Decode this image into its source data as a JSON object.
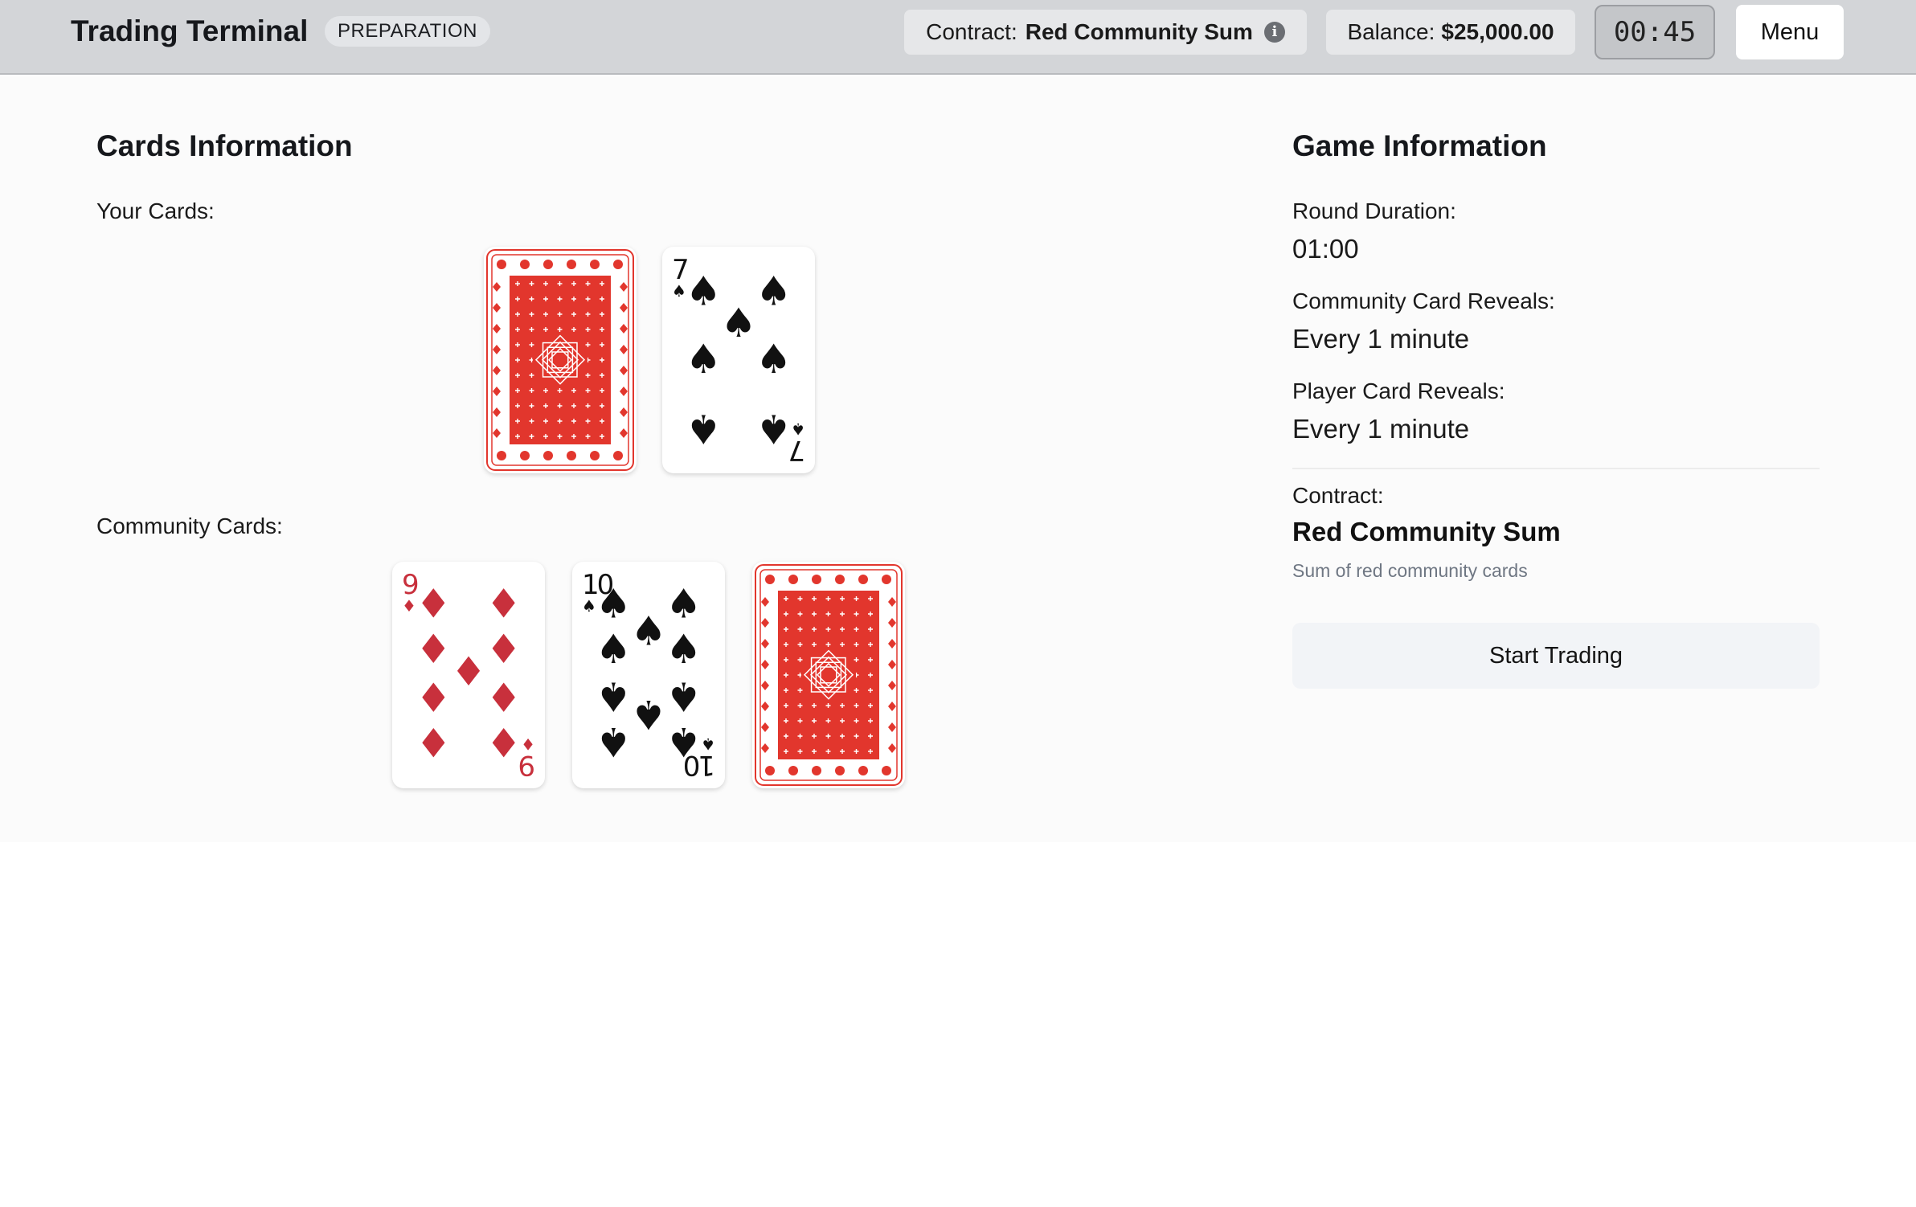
{
  "header": {
    "title": "Trading Terminal",
    "phase": "PREPARATION",
    "contract_label": "Contract:",
    "contract_value": "Red Community Sum",
    "balance_label": "Balance:",
    "balance_value": "$25,000.00",
    "timer": "00:45",
    "menu_label": "Menu"
  },
  "cards_panel": {
    "title": "Cards Information",
    "your_cards_label": "Your Cards:",
    "community_cards_label": "Community Cards:",
    "your_cards": [
      {
        "face": "down"
      },
      {
        "face": "up",
        "rank": "7",
        "suit": "spades"
      }
    ],
    "community_cards": [
      {
        "face": "up",
        "rank": "9",
        "suit": "diamonds"
      },
      {
        "face": "up",
        "rank": "10",
        "suit": "spades"
      },
      {
        "face": "down"
      }
    ]
  },
  "game_panel": {
    "title": "Game Information",
    "round_duration_label": "Round Duration:",
    "round_duration_value": "01:00",
    "community_reveals_label": "Community Card Reveals:",
    "community_reveals_value": "Every 1 minute",
    "player_reveals_label": "Player Card Reveals:",
    "player_reveals_value": "Every 1 minute",
    "contract_label": "Contract:",
    "contract_name": "Red Community Sum",
    "contract_description": "Sum of red community cards",
    "start_button_label": "Start Trading"
  },
  "colors": {
    "card_red": "#c8303c",
    "card_back_red": "#e2362d",
    "spade_black": "#111111"
  }
}
